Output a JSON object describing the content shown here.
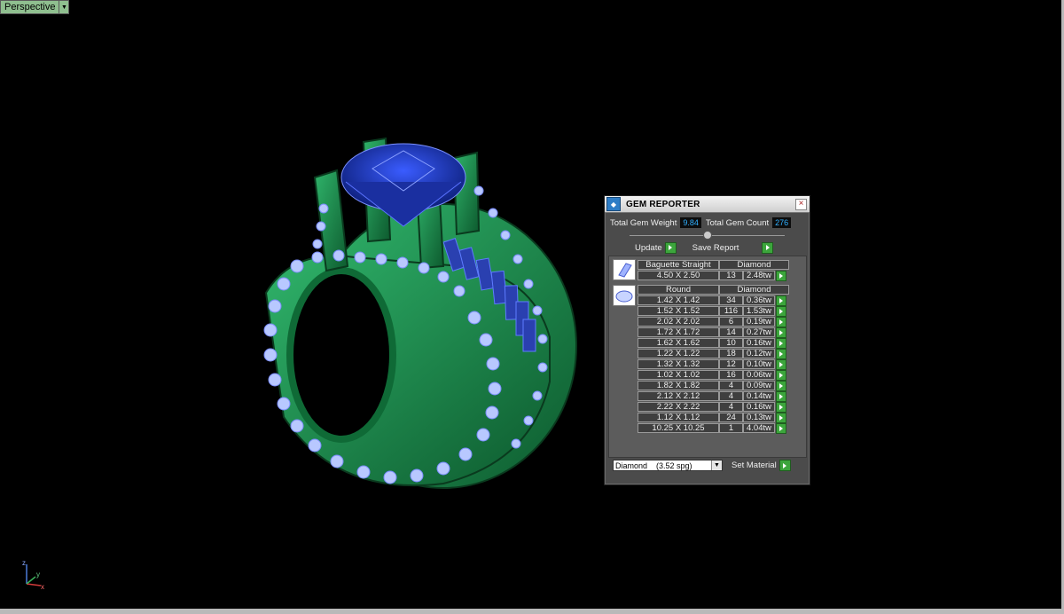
{
  "viewport": {
    "label": "Perspective"
  },
  "axis": {
    "x": "x",
    "y": "y",
    "z": "z"
  },
  "reporter": {
    "title": "GEM REPORTER",
    "total_weight_label": "Total Gem Weight",
    "total_weight_value": "9.84",
    "total_count_label": "Total Gem Count",
    "total_count_value": "276",
    "update_label": "Update",
    "save_label": "Save Report",
    "groups": [
      {
        "shape": "Baguette Straight",
        "material": "Diamond",
        "icon": "baguette-gem-icon",
        "rows": [
          {
            "size": "4.50 X 2.50",
            "count": "13",
            "weight": "2.48tw"
          }
        ]
      },
      {
        "shape": "Round",
        "material": "Diamond",
        "icon": "round-gem-icon",
        "rows": [
          {
            "size": "1.42 X 1.42",
            "count": "34",
            "weight": "0.36tw"
          },
          {
            "size": "1.52 X 1.52",
            "count": "116",
            "weight": "1.53tw"
          },
          {
            "size": "2.02 X 2.02",
            "count": "6",
            "weight": "0.19tw"
          },
          {
            "size": "1.72 X 1.72",
            "count": "14",
            "weight": "0.27tw"
          },
          {
            "size": "1.62 X 1.62",
            "count": "10",
            "weight": "0.16tw"
          },
          {
            "size": "1.22 X 1.22",
            "count": "18",
            "weight": "0.12tw"
          },
          {
            "size": "1.32 X 1.32",
            "count": "12",
            "weight": "0.10tw"
          },
          {
            "size": "1.02 X 1.02",
            "count": "16",
            "weight": "0.06tw"
          },
          {
            "size": "1.82 X 1.82",
            "count": "4",
            "weight": "0.09tw"
          },
          {
            "size": "2.12 X 2.12",
            "count": "4",
            "weight": "0.14tw"
          },
          {
            "size": "2.22 X 2.22",
            "count": "4",
            "weight": "0.16tw"
          },
          {
            "size": "1.12 X 1.12",
            "count": "24",
            "weight": "0.13tw"
          },
          {
            "size": "10.25 X 10.25",
            "count": "1",
            "weight": "4.04tw"
          }
        ]
      }
    ],
    "material_select": "Diamond    (3.52 spg)",
    "set_material_label": "Set Material"
  },
  "colors": {
    "metal": "#1f8a4e",
    "stone": "#1f3fbf",
    "accent_go": "#3ca53c",
    "value_text": "#30b0ff"
  }
}
